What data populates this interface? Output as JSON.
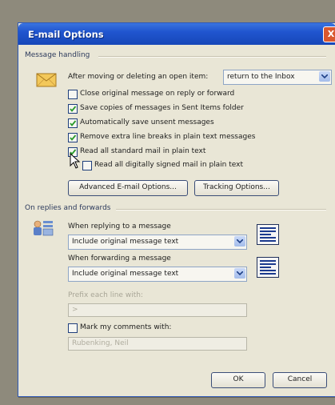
{
  "window": {
    "title": "E-mail Options",
    "close_label": "X"
  },
  "message_handling": {
    "group_label": "Message handling",
    "after_move_label": "After moving or deleting an open item:",
    "after_move_value": "return to the Inbox",
    "options": [
      {
        "label": "Close original message on reply or forward",
        "checked": false
      },
      {
        "label": "Save copies of messages in Sent Items folder",
        "checked": true
      },
      {
        "label": "Automatically save unsent messages",
        "checked": true
      },
      {
        "label": "Remove extra line breaks in plain text messages",
        "checked": true
      },
      {
        "label": "Read all standard mail in plain text",
        "checked": true
      },
      {
        "label": "Read all digitally signed mail in plain text",
        "checked": false
      }
    ],
    "advanced_button": "Advanced E-mail Options...",
    "tracking_button": "Tracking Options..."
  },
  "replies": {
    "group_label": "On replies and forwards",
    "reply_label": "When replying to a message",
    "reply_value": "Include original message text",
    "forward_label": "When forwarding a message",
    "forward_value": "Include original message text",
    "prefix_label": "Prefix each line with:",
    "prefix_value": ">",
    "mark_label": "Mark my comments with:",
    "mark_checked": false,
    "mark_value": "Rubenking, Neil"
  },
  "footer": {
    "ok_label": "OK",
    "cancel_label": "Cancel"
  },
  "icons": {
    "envelope": "envelope-icon",
    "reply_forward": "reply-forward-icon",
    "pattern": "message-layout-icon",
    "cursor": "mouse-pointer-icon"
  }
}
